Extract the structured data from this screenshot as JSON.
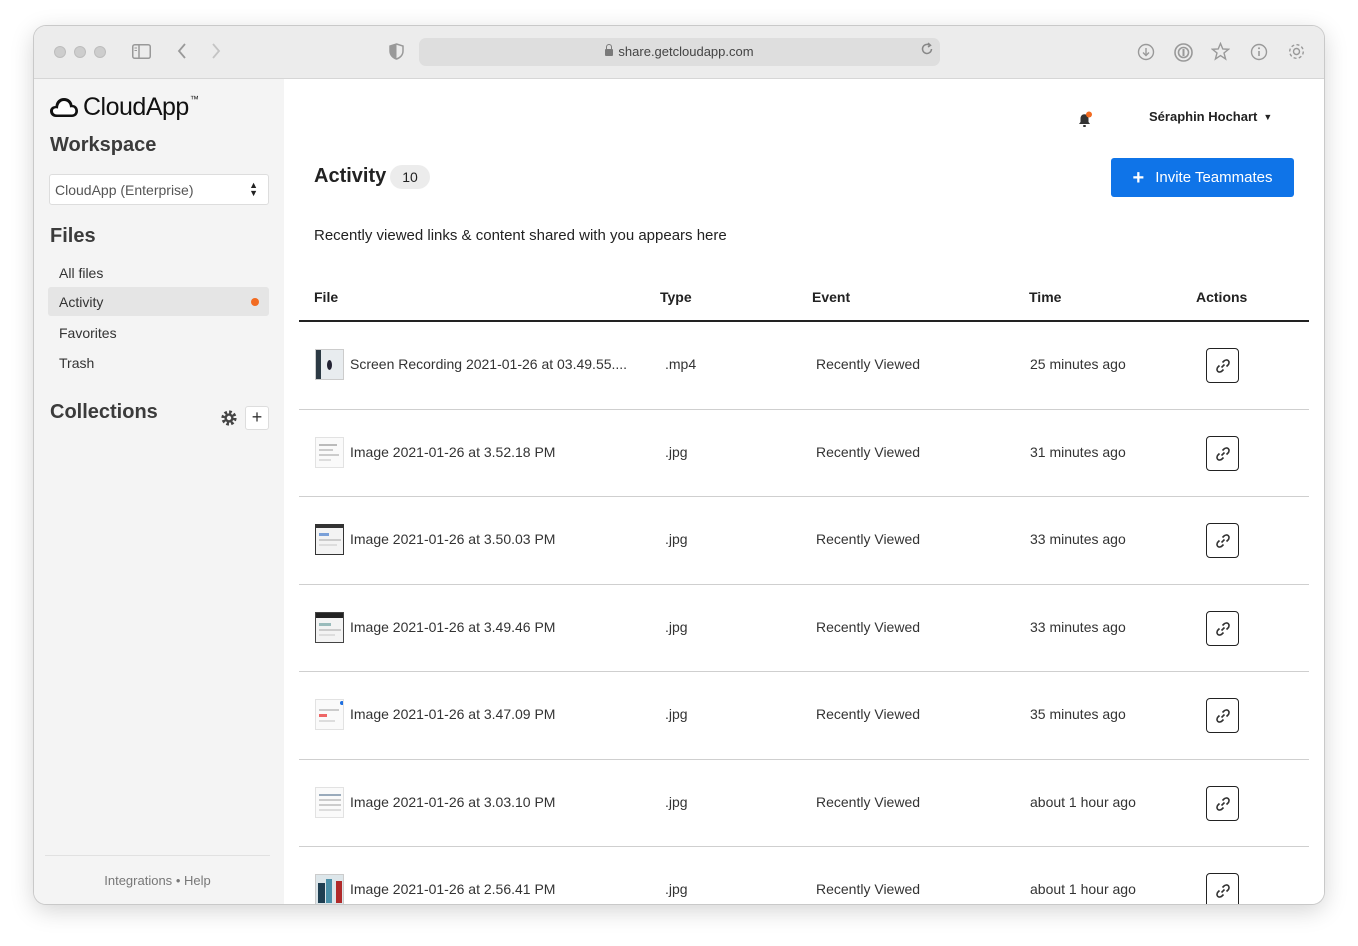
{
  "browser": {
    "url": "share.getcloudapp.com"
  },
  "sidebar": {
    "brand": "CloudApp",
    "brand_tm": "™",
    "workspace_heading": "Workspace",
    "workspace_select": "CloudApp (Enterprise)",
    "files_heading": "Files",
    "nav": [
      {
        "label": "All files"
      },
      {
        "label": "Activity",
        "active": true
      },
      {
        "label": "Favorites"
      },
      {
        "label": "Trash"
      }
    ],
    "collections_heading": "Collections",
    "footer": {
      "integrations": "Integrations",
      "separator": "•",
      "help": "Help"
    }
  },
  "header": {
    "user_name": "Séraphin Hochart"
  },
  "main": {
    "title": "Activity",
    "count": "10",
    "invite_label": "Invite Teammates",
    "subtitle": "Recently viewed links & content shared with you appears here",
    "columns": {
      "file": "File",
      "type": "Type",
      "event": "Event",
      "time": "Time",
      "actions": "Actions"
    },
    "rows": [
      {
        "name": "Screen Recording 2021-01-26 at 03.49.55....",
        "type": ".mp4",
        "event": "Recently Viewed",
        "time": "25 minutes ago"
      },
      {
        "name": "Image 2021-01-26 at 3.52.18 PM",
        "type": ".jpg",
        "event": "Recently Viewed",
        "time": "31 minutes ago"
      },
      {
        "name": "Image 2021-01-26 at 3.50.03 PM",
        "type": ".jpg",
        "event": "Recently Viewed",
        "time": "33 minutes ago"
      },
      {
        "name": "Image 2021-01-26 at 3.49.46 PM",
        "type": ".jpg",
        "event": "Recently Viewed",
        "time": "33 minutes ago"
      },
      {
        "name": "Image 2021-01-26 at 3.47.09 PM",
        "type": ".jpg",
        "event": "Recently Viewed",
        "time": "35 minutes ago"
      },
      {
        "name": "Image 2021-01-26 at 3.03.10 PM",
        "type": ".jpg",
        "event": "Recently Viewed",
        "time": "about 1 hour ago"
      },
      {
        "name": "Image 2021-01-26 at 2.56.41 PM",
        "type": ".jpg",
        "event": "Recently Viewed",
        "time": "about 1 hour ago"
      }
    ]
  },
  "icons": {
    "sidebar_toggle": "sidebar-icon",
    "back": "chevron-left-icon",
    "forward": "chevron-right-icon",
    "privacy": "shield-icon",
    "lock": "lock-icon",
    "reload": "reload-icon",
    "download": "download-icon",
    "password": "password-icon",
    "bookmark": "star-icon",
    "info": "info-icon",
    "settings": "gear-icon",
    "notifications": "bell-icon",
    "copy_link": "link-icon"
  },
  "colors": {
    "accent": "#0f74e8",
    "notification_dot": "#f26b21"
  }
}
